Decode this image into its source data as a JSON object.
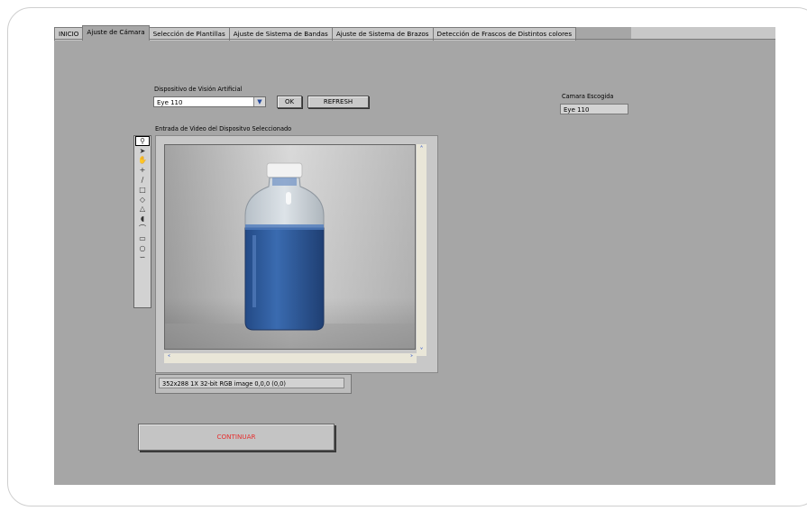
{
  "tabs": [
    {
      "label": "INICIO",
      "active": false
    },
    {
      "label": "Ajuste de Cámara",
      "active": true
    },
    {
      "label": "Selección de Plantillas",
      "active": false
    },
    {
      "label": "Ajuste de Sistema de Bandas",
      "active": false
    },
    {
      "label": "Ajuste de Sistema de Brazos",
      "active": false
    },
    {
      "label": "Detección de Frascos de Distintos colores",
      "active": false
    }
  ],
  "device": {
    "label": "Dispositivo de Visión Artificial",
    "selected": "Eye 110",
    "ok_label": "OK",
    "refresh_label": "REFRESH"
  },
  "chosen_camera": {
    "label": "Camara Escogida",
    "value": "Eye 110"
  },
  "video": {
    "label": "Entrada de Video del Dispositvo Seleccionado",
    "status": "352x288 1X 32-bit RGB image 0,0,0    (0,0)"
  },
  "tools": [
    "zoom-icon",
    "pointer-icon",
    "pan-icon",
    "crosshair-icon",
    "line-icon",
    "rectangle-icon",
    "rotated-rectangle-icon",
    "polygon-icon",
    "freehand-icon",
    "annulus-icon",
    "freehand-region-icon",
    "oval-icon",
    "broken-line-icon"
  ],
  "continue_label": "CONTINUAR",
  "colors": {
    "panel": "#a6a6a6",
    "continue_text": "#e53030",
    "bottle_liquid": "#2f5c9e"
  }
}
